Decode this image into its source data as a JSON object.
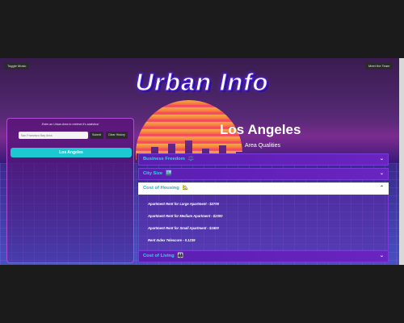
{
  "header": {
    "toggle_music_label": "Toggle Music",
    "meet_team_label": "Meet the Team",
    "app_title": "Urban Info"
  },
  "search": {
    "prompt": "Enter an Urban Area to retrieve it's statistics!",
    "placeholder": "San Francisco Bay Area",
    "submit_label": "Submit",
    "clear_label": "Clear History",
    "history": [
      "Los Angeles"
    ]
  },
  "result": {
    "city": "Los Angeles",
    "section_title": "Area Qualities",
    "accordion": [
      {
        "label": "Business Freedom",
        "icon": "⚖️",
        "icon_name": "scales-icon",
        "expanded": false
      },
      {
        "label": "City Size",
        "icon": "🏙️",
        "icon_name": "cityscape-icon",
        "expanded": false
      },
      {
        "label": "Cost of Housing",
        "icon": "🏡",
        "icon_name": "house-icon",
        "expanded": true
      },
      {
        "label": "Cost of Living",
        "icon": "👨‍👩‍👧",
        "icon_name": "family-icon",
        "expanded": false
      }
    ],
    "housing_stats": [
      "Apartment Rent for Large Apartment - $2700",
      "Apartment Rent for Medium Apartment - $2300",
      "Apartment Rent for Small Apartment - $1800",
      "Rent Index Telescore - 0.1239"
    ]
  },
  "colors": {
    "accent_cyan": "#1ec8d0",
    "title_stroke": "#4a1fd0",
    "panel_border": "#b04bd8"
  }
}
